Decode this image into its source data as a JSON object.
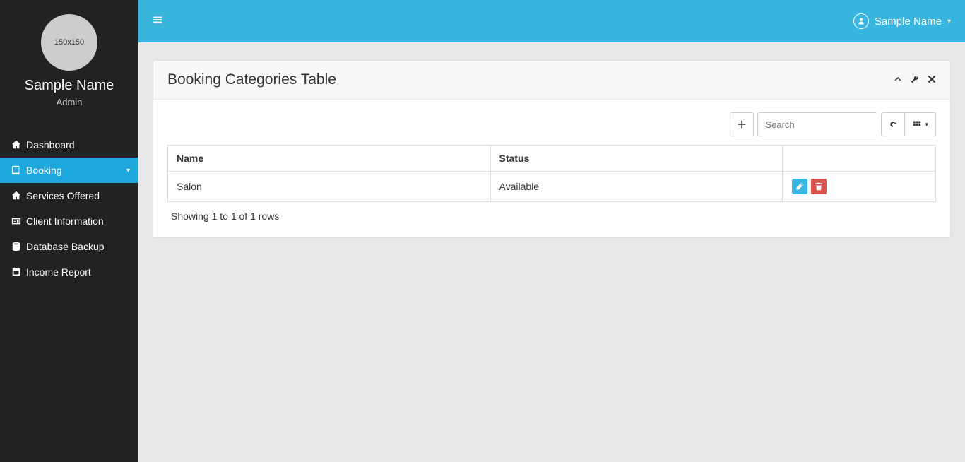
{
  "sidebar": {
    "avatar_text": "150x150",
    "user_name": "Sample Name",
    "user_role": "Admin",
    "items": [
      {
        "label": "Dashboard"
      },
      {
        "label": "Booking"
      },
      {
        "label": "Services Offered"
      },
      {
        "label": "Client Information"
      },
      {
        "label": "Database Backup"
      },
      {
        "label": "Income Report"
      }
    ]
  },
  "topbar": {
    "user_name": "Sample Name"
  },
  "panel": {
    "title": "Booking Categories Table",
    "search_placeholder": "Search",
    "columns": {
      "name": "Name",
      "status": "Status"
    },
    "rows": [
      {
        "name": "Salon",
        "status": "Available"
      }
    ],
    "footer": "Showing 1 to 1 of 1 rows"
  },
  "colors": {
    "accent": "#39b6e0",
    "danger": "#d9534f",
    "sidebar_bg": "#222222"
  }
}
